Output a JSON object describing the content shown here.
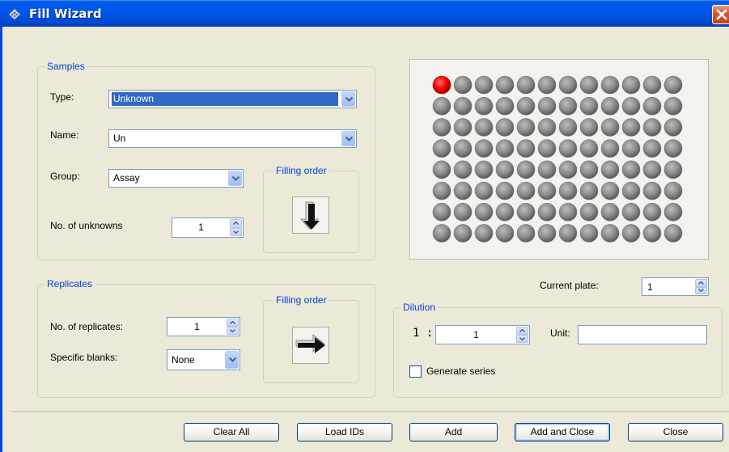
{
  "window": {
    "title": "Fill Wizard"
  },
  "samples": {
    "legend": "Samples",
    "type_label": "Type:",
    "type_value": "Unknown",
    "name_label": "Name:",
    "name_value": "Un",
    "group_label": "Group:",
    "group_value": "Assay",
    "num_unknowns_label": "No. of unknowns",
    "num_unknowns_value": "1",
    "filling_order_label": "Filling order",
    "filling_order_direction": "down"
  },
  "replicates": {
    "legend": "Replicates",
    "num_replicates_label": "No. of replicates:",
    "num_replicates_value": "1",
    "specific_blanks_label": "Specific blanks:",
    "specific_blanks_value": "None",
    "filling_order_label": "Filling order",
    "filling_order_direction": "right"
  },
  "plate": {
    "rows": 8,
    "columns": 12,
    "selected_wells": [
      [
        0,
        0
      ]
    ],
    "well_color": "#8A8A8A",
    "selected_color": "#EE0000"
  },
  "current_plate": {
    "label": "Current plate:",
    "value": "1"
  },
  "dilution": {
    "legend": "Dilution",
    "prefix": "1 :",
    "value": "1",
    "unit_label": "Unit:",
    "unit_value": "",
    "generate_series_label": "Generate series",
    "generate_series_checked": false
  },
  "buttons": {
    "clear_all": "Clear All",
    "load_ids": "Load IDs",
    "add": "Add",
    "add_and_close": "Add and Close",
    "close": "Close"
  },
  "icons": {
    "app": "fill-wizard-app-icon",
    "close": "close-x-icon",
    "dropdown": "chevron-down-icon",
    "spin": "spin-up-down-icon",
    "order_down": "arrow-down-icon",
    "order_right": "arrow-right-icon"
  }
}
